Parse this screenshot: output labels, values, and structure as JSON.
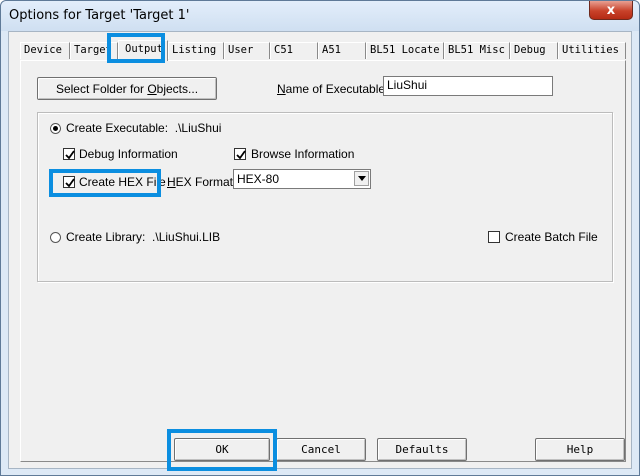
{
  "window": {
    "title": "Options for Target 'Target 1'",
    "close_glyph": "x"
  },
  "tabs": [
    {
      "label": "Device"
    },
    {
      "label": "Target"
    },
    {
      "label": "Output",
      "active": true
    },
    {
      "label": "Listing"
    },
    {
      "label": "User"
    },
    {
      "label": "C51"
    },
    {
      "label": "A51"
    },
    {
      "label": "BL51 Locate"
    },
    {
      "label": "BL51 Misc"
    },
    {
      "label": "Debug"
    },
    {
      "label": "Utilities"
    }
  ],
  "output": {
    "select_folder_pre": "Select Folder for ",
    "select_folder_accel": "O",
    "select_folder_post": "bjects...",
    "name_exec_accel": "N",
    "name_exec_label": "ame of Executable:",
    "name_exec_value": "LiuShui",
    "create_exec_label": "Create Executable:",
    "create_exec_path": ".\\LiuShui",
    "create_exec_selected": true,
    "debug_info_label": "Debug Information",
    "debug_info_checked": true,
    "browse_info_label": "Browse Information",
    "browse_info_checked": true,
    "create_hex_label": "Create HEX File",
    "create_hex_checked": true,
    "hex_format_accel": "H",
    "hex_format_label": "EX Format:",
    "hex_format_value": "HEX-80",
    "create_lib_label": "Create Library:",
    "create_lib_path": ".\\LiuShui.LIB",
    "create_lib_selected": false,
    "batch_label": "Create Batch File",
    "batch_checked": false
  },
  "footer": {
    "ok": "OK",
    "cancel": "Cancel",
    "defaults": "Defaults",
    "help": "Help"
  },
  "colors": {
    "highlight": "#0b8ee0"
  }
}
